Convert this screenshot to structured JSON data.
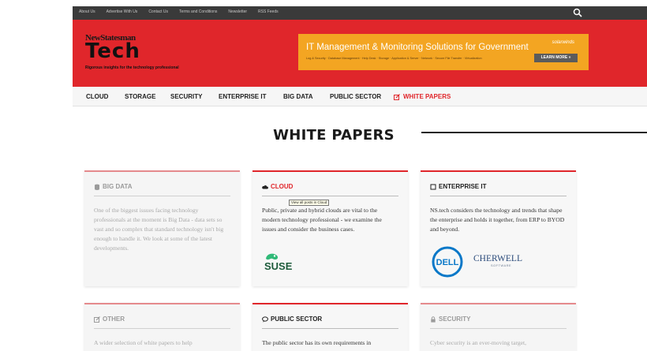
{
  "topbar": {
    "links": [
      "About Us",
      "Advertise With Us",
      "Contact Us",
      "Terms and Conditions",
      "Newsletter",
      "RSS Feeds"
    ]
  },
  "header": {
    "brand": "NewStatesman",
    "logo": "Tech",
    "tagline": "Rigorous insights for the technology professional",
    "ad": {
      "title": "IT Management & Monitoring Solutions for Government",
      "subtitle": "Log & Security · Database Management · Help Desk · Storage · Application & Server · Network · Secure File Transfer · Virtualization",
      "advertiser": "solarwinds",
      "cta": "LEARN MORE »"
    }
  },
  "nav": {
    "items": [
      "CLOUD",
      "STORAGE",
      "SECURITY",
      "ENTERPRISE IT",
      "BIG DATA",
      "PUBLIC SECTOR",
      "WHITE PAPERS"
    ],
    "active": "WHITE PAPERS"
  },
  "page": {
    "title": "WHITE PAPERS"
  },
  "tooltip": "View all posts in Cloud",
  "cards": [
    {
      "heading": "BIG DATA",
      "icon": "database-icon",
      "body": "One of the biggest issues facing technology professionals at the moment is Big Data - data sets so vast and so complex that standard technology isn't big enough to handle it. We look at some of the latest developments."
    },
    {
      "heading": "CLOUD",
      "icon": "cloud-icon",
      "body": "Public, private and hybrid clouds are vital to the modern technology professional - we examine the issues and consider the business cases.",
      "logos": [
        "SUSE"
      ]
    },
    {
      "heading": "ENTERPRISE IT",
      "icon": "square-icon",
      "body": "NS.tech considers the technology and trends that shape the enterprise and holds it together, from ERP to BYOD and beyond.",
      "logos": [
        "DELL",
        "CHERWELL",
        "SOFTWARE"
      ]
    },
    {
      "heading": "OTHER",
      "icon": "edit-icon",
      "body": "A wider selection of white papers to help"
    },
    {
      "heading": "PUBLIC SECTOR",
      "icon": "chat-icon",
      "body": "The public sector has its own requirements in"
    },
    {
      "heading": "SECURITY",
      "icon": "lock-icon",
      "body": "Cyber security is an ever-moving target,"
    }
  ],
  "colors": {
    "brand_red": "#e0262b",
    "ad_orange": "#f3a522",
    "topbar": "#3a3a3a"
  }
}
